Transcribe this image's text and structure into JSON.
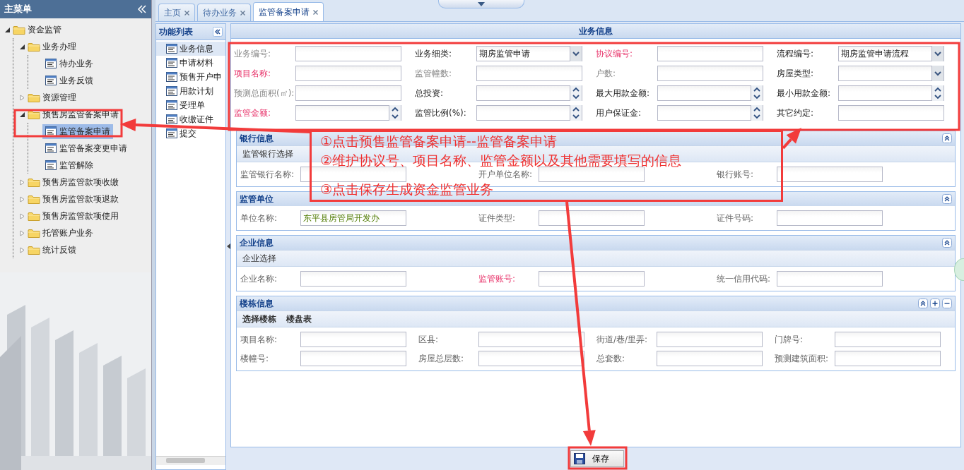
{
  "sidebar": {
    "title": "主菜单",
    "tree": [
      {
        "label": "资金监管",
        "kind": "folder",
        "expanded": true,
        "children": [
          {
            "label": "业务办理",
            "kind": "folder",
            "expanded": true,
            "children": [
              {
                "label": "待办业务",
                "kind": "leaf",
                "selected": false
              },
              {
                "label": "业务反馈",
                "kind": "leaf",
                "selected": false
              }
            ]
          },
          {
            "label": "资源管理",
            "kind": "folder",
            "expanded": false
          },
          {
            "label": "预售房监管备案申请",
            "kind": "folder",
            "expanded": true,
            "children": [
              {
                "label": "监管备案申请",
                "kind": "leaf",
                "selected": true
              },
              {
                "label": "监管备案变更申请",
                "kind": "leaf",
                "selected": false
              },
              {
                "label": "监管解除",
                "kind": "leaf",
                "selected": false
              }
            ]
          },
          {
            "label": "预售房监管款项收缴",
            "kind": "folder",
            "expanded": false
          },
          {
            "label": "预售房监管款项退款",
            "kind": "folder",
            "expanded": false
          },
          {
            "label": "预售房监管款项使用",
            "kind": "folder",
            "expanded": false
          },
          {
            "label": "托管账户业务",
            "kind": "folder",
            "expanded": false
          },
          {
            "label": "统计反馈",
            "kind": "folder",
            "expanded": false
          }
        ]
      }
    ]
  },
  "tabs": [
    {
      "label": "主页",
      "selected": false
    },
    {
      "label": "待办业务",
      "selected": false
    },
    {
      "label": "监管备案申请",
      "selected": true
    }
  ],
  "function_list": {
    "title": "功能列表",
    "items": [
      {
        "label": "业务信息",
        "selected": true
      },
      {
        "label": "申请材料",
        "selected": false
      },
      {
        "label": "预售开户申",
        "selected": false
      },
      {
        "label": "用款计划",
        "selected": false
      },
      {
        "label": "受理单",
        "selected": false
      },
      {
        "label": "收缴证件",
        "selected": false
      },
      {
        "label": "提交",
        "selected": false
      }
    ]
  },
  "form": {
    "title": "业务信息",
    "fields": [
      {
        "label": "业务编号:",
        "kind": "text",
        "required": false,
        "disabled": true
      },
      {
        "label": "业务细类:",
        "kind": "select",
        "required": false,
        "disabled": false,
        "value": "期房监管申请"
      },
      {
        "label": "协议编号:",
        "kind": "text",
        "required": true,
        "disabled": false
      },
      {
        "label": "流程编号:",
        "kind": "select",
        "required": false,
        "disabled": false,
        "value": "期房监管申请流程"
      },
      {
        "label": "项目名称:",
        "kind": "text",
        "required": true,
        "disabled": false
      },
      {
        "label": "监管幢数:",
        "kind": "text",
        "required": false,
        "disabled": true
      },
      {
        "label": "户数:",
        "kind": "text",
        "required": false,
        "disabled": true
      },
      {
        "label": "房屋类型:",
        "kind": "select",
        "required": false,
        "disabled": false
      },
      {
        "label": "预测总面积(㎡):",
        "kind": "text",
        "required": false,
        "disabled": true
      },
      {
        "label": "总投资:",
        "kind": "spinner",
        "required": false,
        "disabled": false
      },
      {
        "label": "最大用款金额:",
        "kind": "spinner",
        "required": false,
        "disabled": false
      },
      {
        "label": "最小用款金额:",
        "kind": "spinner",
        "required": false,
        "disabled": false
      },
      {
        "label": "监管金额:",
        "kind": "spinner",
        "required": true,
        "disabled": false
      },
      {
        "label": "监管比例(%):",
        "kind": "spinner",
        "required": false,
        "disabled": false
      },
      {
        "label": "用户保证金:",
        "kind": "spinner",
        "required": false,
        "disabled": false
      },
      {
        "label": "其它约定:",
        "kind": "text",
        "required": false,
        "disabled": false
      }
    ]
  },
  "sections": [
    {
      "title": "银行信息",
      "add_remove": false,
      "toolbar": [
        {
          "label": "监管银行选择",
          "bold": false
        }
      ],
      "fields": [
        {
          "label": "监管银行名称:",
          "required": false
        },
        {
          "label": "开户单位名称:",
          "required": false
        },
        {
          "label": "银行账号:",
          "required": false
        }
      ]
    },
    {
      "title": "监管单位",
      "add_remove": false,
      "fields": [
        {
          "label": "单位名称:",
          "required": false,
          "value": "东平县房管局开发办"
        },
        {
          "label": "证件类型:",
          "required": false
        },
        {
          "label": "证件号码:",
          "required": false
        }
      ]
    },
    {
      "title": "企业信息",
      "add_remove": false,
      "toolbar": [
        {
          "label": "企业选择",
          "bold": false
        }
      ],
      "fields": [
        {
          "label": "企业名称:",
          "required": false
        },
        {
          "label": "监管账号:",
          "required": true
        },
        {
          "label": "统一信用代码:",
          "required": false
        }
      ]
    },
    {
      "title": "楼栋信息",
      "add_remove": true,
      "toolbar": [
        {
          "label": "选择楼栋",
          "bold": true
        },
        {
          "label": "楼盘表",
          "bold": true
        }
      ],
      "fields": [
        {
          "label": "项目名称:",
          "required": false
        },
        {
          "label": "区县:",
          "required": false
        },
        {
          "label": "街道/巷/里弄:",
          "required": false
        },
        {
          "label": "门牌号:",
          "required": false
        },
        {
          "label": "楼幢号:",
          "required": false
        },
        {
          "label": "房屋总层数:",
          "required": false
        },
        {
          "label": "总套数:",
          "required": false
        },
        {
          "label": "预测建筑面积:",
          "required": false
        }
      ]
    }
  ],
  "save_button": {
    "label": "保存"
  },
  "annotation": {
    "lines": [
      "①点击预售监管备案申请--监管备案申请",
      "②维护协议号、项目名称、监管金额以及其他需要填写的信息",
      "③点击保存生成资金监管业务"
    ]
  }
}
